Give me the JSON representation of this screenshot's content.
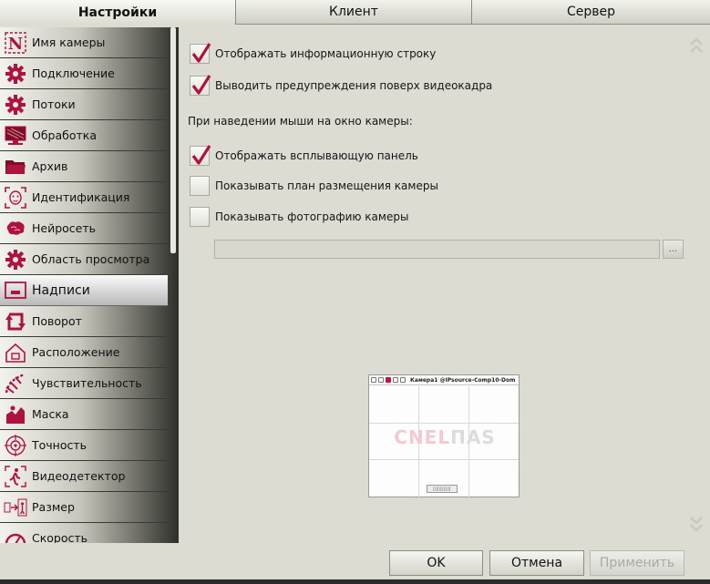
{
  "tabs": [
    {
      "label": "Настройки",
      "active": true
    },
    {
      "label": "Клиент",
      "active": false
    },
    {
      "label": "Сервер",
      "active": false
    }
  ],
  "sidebar": {
    "items": [
      {
        "label": "Имя камеры",
        "icon": "camera-name-icon"
      },
      {
        "label": "Подключение",
        "icon": "gear-icon"
      },
      {
        "label": "Потоки",
        "icon": "gear-icon"
      },
      {
        "label": "Обработка",
        "icon": "monitor-icon"
      },
      {
        "label": "Архив",
        "icon": "folder-icon"
      },
      {
        "label": "Идентификация",
        "icon": "face-icon"
      },
      {
        "label": "Нейросеть",
        "icon": "brain-icon"
      },
      {
        "label": "Область просмотра",
        "icon": "gear-icon"
      },
      {
        "label": "Надписи",
        "icon": "caption-icon",
        "selected": true
      },
      {
        "label": "Поворот",
        "icon": "rotate-icon"
      },
      {
        "label": "Расположение",
        "icon": "house-icon"
      },
      {
        "label": "Чувствительность",
        "icon": "sensitivity-icon"
      },
      {
        "label": "Маска",
        "icon": "mask-icon"
      },
      {
        "label": "Точность",
        "icon": "target-icon"
      },
      {
        "label": "Видеодетектор",
        "icon": "motion-detector-icon"
      },
      {
        "label": "Размер",
        "icon": "size-icon"
      },
      {
        "label": "Скорость",
        "icon": "speed-icon"
      }
    ]
  },
  "main": {
    "show_info_line": {
      "label": "Отображать информационную строку",
      "checked": true
    },
    "warnings_over_frame": {
      "label": "Выводить предупреждения поверх видеокадра",
      "checked": true
    },
    "hover_section_label": "При наведении мыши на окно камеры:",
    "show_popup_panel": {
      "label": "Отображать всплывающую панель",
      "checked": true
    },
    "show_placement_plan": {
      "label": "Показывать план размещения камеры",
      "checked": false
    },
    "show_camera_photo": {
      "label": "Показывать фотографию камеры",
      "checked": false
    },
    "photo_path": {
      "value": ""
    },
    "browse_label": "...",
    "preview": {
      "title": "Камера1 @IPsource-Comp10-Dom",
      "logo_main": "CNEL",
      "logo_tail": "ПАS"
    }
  },
  "buttons": {
    "ok": "OK",
    "cancel": "Отмена",
    "apply": "Применить"
  },
  "colors": {
    "accent": "#b0123f",
    "background": "#dddcd2"
  }
}
